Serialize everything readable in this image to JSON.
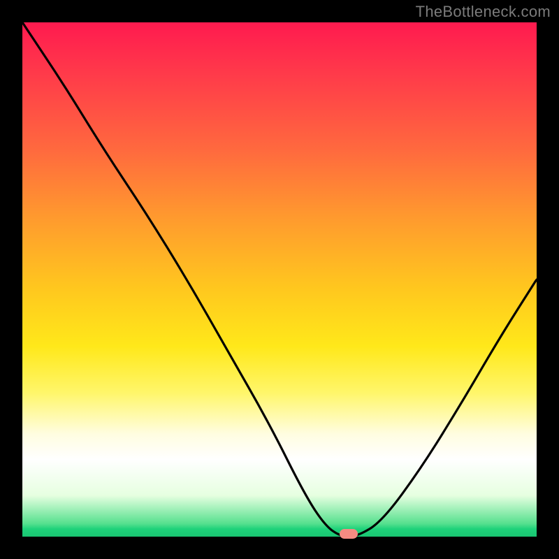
{
  "watermark": "TheBottleneck.com",
  "chart_data": {
    "type": "line",
    "title": "",
    "xlabel": "",
    "ylabel": "",
    "xlim": [
      0,
      1
    ],
    "ylim": [
      0,
      1
    ],
    "grid": false,
    "legend": false,
    "series": [
      {
        "name": "curve",
        "x": [
          0.0,
          0.08,
          0.16,
          0.24,
          0.32,
          0.4,
          0.48,
          0.55,
          0.59,
          0.62,
          0.65,
          0.7,
          0.78,
          0.86,
          0.93,
          1.0
        ],
        "y": [
          1.0,
          0.88,
          0.75,
          0.63,
          0.5,
          0.36,
          0.22,
          0.08,
          0.02,
          0.0,
          0.0,
          0.03,
          0.14,
          0.27,
          0.39,
          0.5
        ]
      }
    ],
    "marker": {
      "x": 0.635,
      "y": 0.0
    },
    "background_gradient_stops": [
      {
        "pos": 0.0,
        "color": "#ff1a4f"
      },
      {
        "pos": 0.25,
        "color": "#ff6a3e"
      },
      {
        "pos": 0.52,
        "color": "#ffc81e"
      },
      {
        "pos": 0.72,
        "color": "#fff66a"
      },
      {
        "pos": 0.85,
        "color": "#ffffff"
      },
      {
        "pos": 0.98,
        "color": "#1fd27a"
      },
      {
        "pos": 1.0,
        "color": "#19c572"
      }
    ]
  },
  "colors": {
    "frame": "#000000",
    "curve": "#000000",
    "marker": "#f58b82",
    "watermark": "#7b7b7b"
  }
}
